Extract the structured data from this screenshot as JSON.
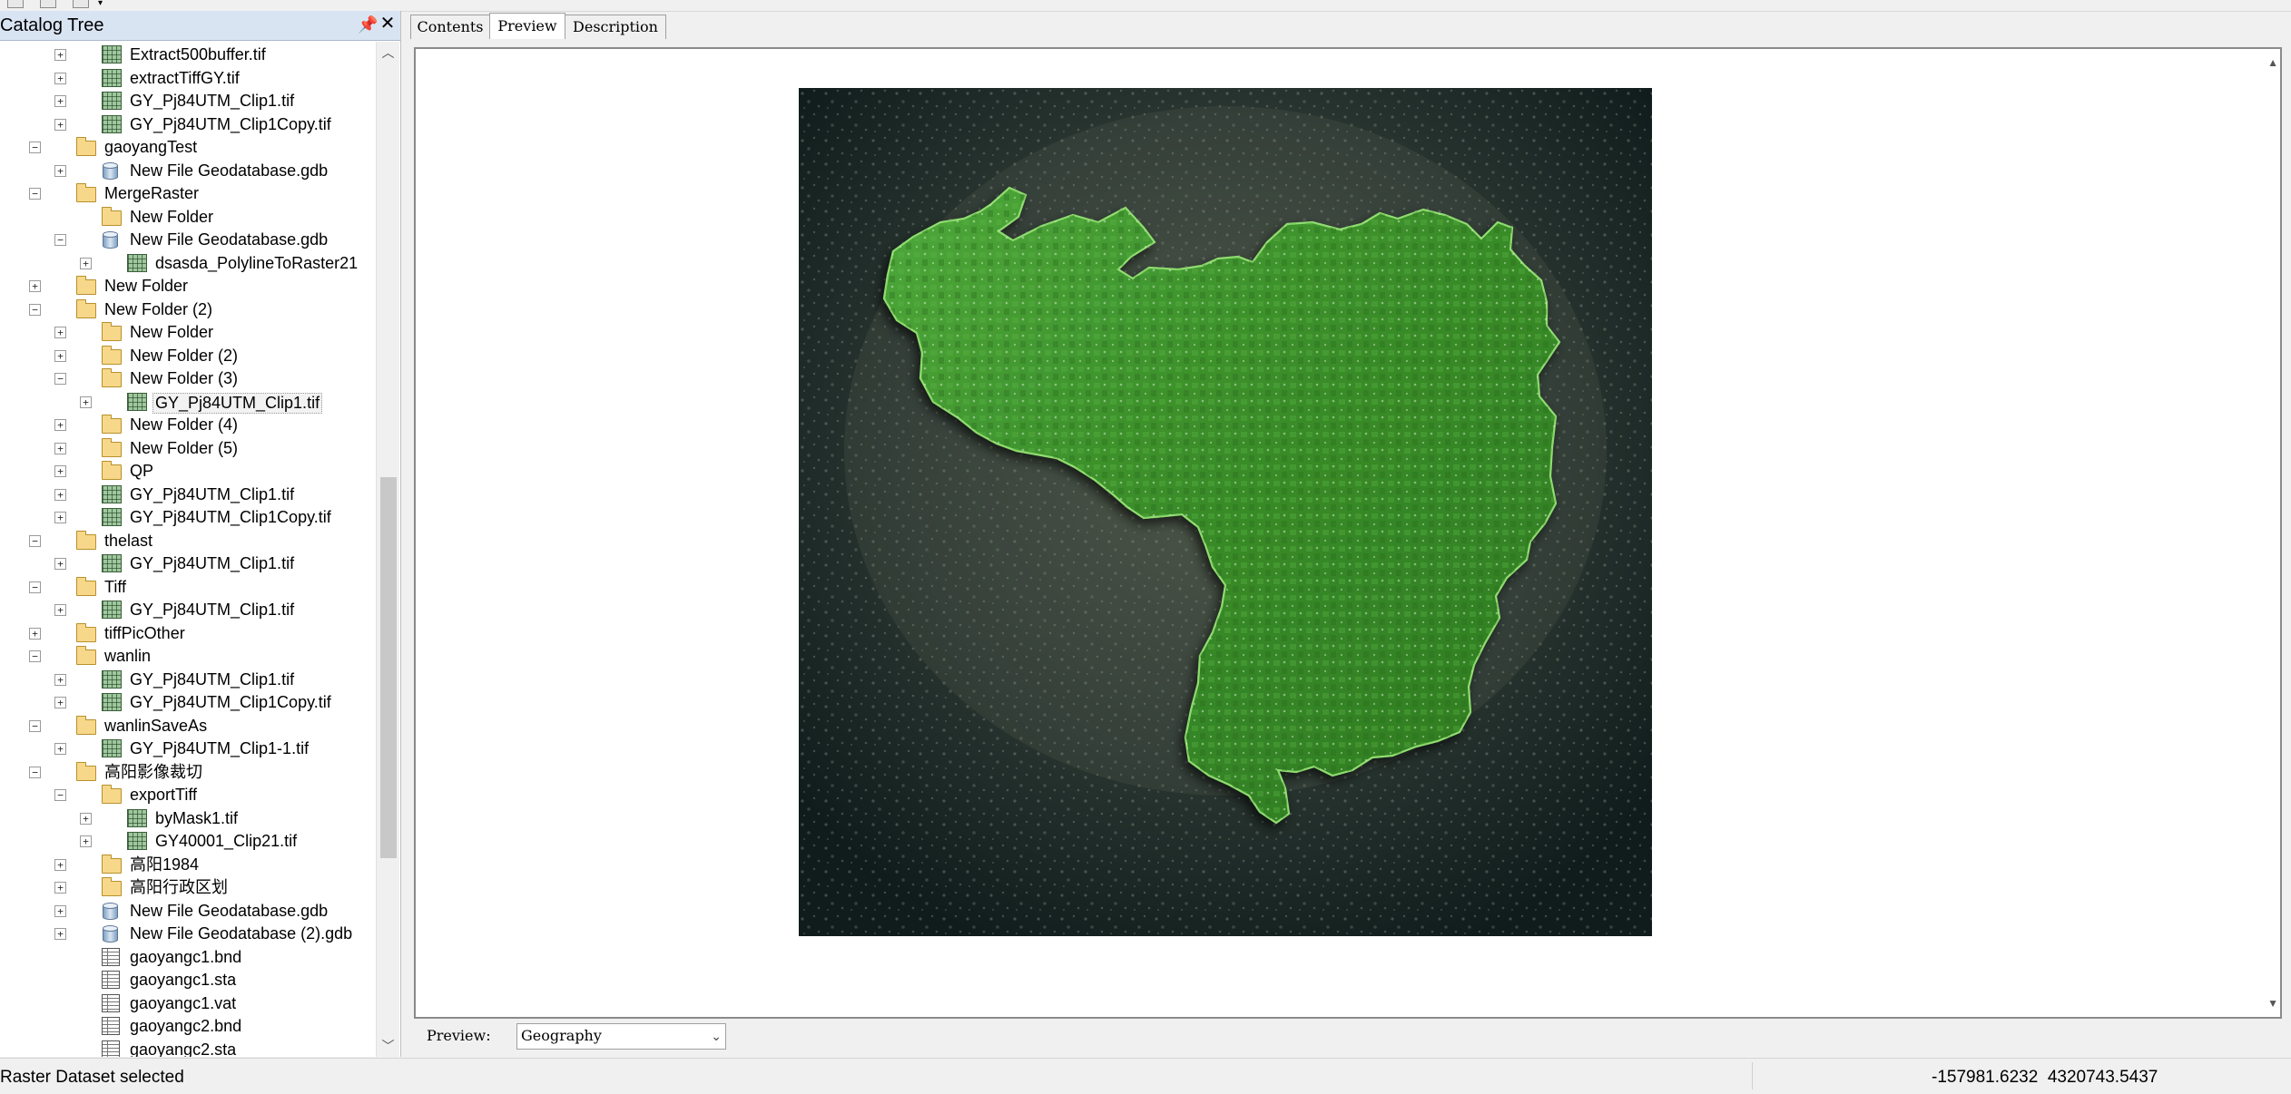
{
  "catalog": {
    "title": "Catalog Tree",
    "pin_glyph": "📌",
    "close_glyph": "✕",
    "items": [
      {
        "label": "Extract500buffer.tif",
        "indent": 2,
        "expander": "plus",
        "icon": "raster"
      },
      {
        "label": "extractTiffGY.tif",
        "indent": 2,
        "expander": "plus",
        "icon": "raster"
      },
      {
        "label": "GY_Pj84UTM_Clip1.tif",
        "indent": 2,
        "expander": "plus",
        "icon": "raster"
      },
      {
        "label": "GY_Pj84UTM_Clip1Copy.tif",
        "indent": 2,
        "expander": "plus",
        "icon": "raster"
      },
      {
        "label": "gaoyangTest",
        "indent": 1,
        "expander": "minus",
        "icon": "folder"
      },
      {
        "label": "New File Geodatabase.gdb",
        "indent": 2,
        "expander": "plus",
        "icon": "gdb"
      },
      {
        "label": "MergeRaster",
        "indent": 1,
        "expander": "minus",
        "icon": "folder"
      },
      {
        "label": "New Folder",
        "indent": 2,
        "expander": "none",
        "icon": "folder"
      },
      {
        "label": "New File Geodatabase.gdb",
        "indent": 2,
        "expander": "minus",
        "icon": "gdb"
      },
      {
        "label": "dsasda_PolylineToRaster21",
        "indent": 3,
        "expander": "plus",
        "icon": "raster"
      },
      {
        "label": "New Folder",
        "indent": 1,
        "expander": "plus",
        "icon": "folder"
      },
      {
        "label": "New Folder (2)",
        "indent": 1,
        "expander": "minus",
        "icon": "folder"
      },
      {
        "label": "New Folder",
        "indent": 2,
        "expander": "plus",
        "icon": "folder"
      },
      {
        "label": "New Folder (2)",
        "indent": 2,
        "expander": "plus",
        "icon": "folder"
      },
      {
        "label": "New Folder (3)",
        "indent": 2,
        "expander": "minus",
        "icon": "folder"
      },
      {
        "label": "GY_Pj84UTM_Clip1.tif",
        "indent": 3,
        "expander": "plus",
        "icon": "raster",
        "selected": true
      },
      {
        "label": "New Folder (4)",
        "indent": 2,
        "expander": "plus",
        "icon": "folder"
      },
      {
        "label": "New Folder (5)",
        "indent": 2,
        "expander": "plus",
        "icon": "folder"
      },
      {
        "label": "QP",
        "indent": 2,
        "expander": "plus",
        "icon": "folder"
      },
      {
        "label": "GY_Pj84UTM_Clip1.tif",
        "indent": 2,
        "expander": "plus",
        "icon": "raster"
      },
      {
        "label": "GY_Pj84UTM_Clip1Copy.tif",
        "indent": 2,
        "expander": "plus",
        "icon": "raster"
      },
      {
        "label": "thelast",
        "indent": 1,
        "expander": "minus",
        "icon": "folder"
      },
      {
        "label": "GY_Pj84UTM_Clip1.tif",
        "indent": 2,
        "expander": "plus",
        "icon": "raster"
      },
      {
        "label": "Tiff",
        "indent": 1,
        "expander": "minus",
        "icon": "folder"
      },
      {
        "label": "GY_Pj84UTM_Clip1.tif",
        "indent": 2,
        "expander": "plus",
        "icon": "raster"
      },
      {
        "label": "tiffPicOther",
        "indent": 1,
        "expander": "plus",
        "icon": "folder"
      },
      {
        "label": "wanlin",
        "indent": 1,
        "expander": "minus",
        "icon": "folder"
      },
      {
        "label": "GY_Pj84UTM_Clip1.tif",
        "indent": 2,
        "expander": "plus",
        "icon": "raster"
      },
      {
        "label": "GY_Pj84UTM_Clip1Copy.tif",
        "indent": 2,
        "expander": "plus",
        "icon": "raster"
      },
      {
        "label": "wanlinSaveAs",
        "indent": 1,
        "expander": "minus",
        "icon": "folder"
      },
      {
        "label": "GY_Pj84UTM_Clip1-1.tif",
        "indent": 2,
        "expander": "plus",
        "icon": "raster"
      },
      {
        "label": "高阳影像裁切",
        "indent": 1,
        "expander": "minus",
        "icon": "folder"
      },
      {
        "label": "exportTiff",
        "indent": 2,
        "expander": "minus",
        "icon": "folder"
      },
      {
        "label": "byMask1.tif",
        "indent": 3,
        "expander": "plus",
        "icon": "raster"
      },
      {
        "label": "GY40001_Clip21.tif",
        "indent": 3,
        "expander": "plus",
        "icon": "raster"
      },
      {
        "label": "高阳1984",
        "indent": 2,
        "expander": "plus",
        "icon": "folder"
      },
      {
        "label": "高阳行政区划",
        "indent": 2,
        "expander": "plus",
        "icon": "folder"
      },
      {
        "label": "New File Geodatabase.gdb",
        "indent": 2,
        "expander": "plus",
        "icon": "gdb"
      },
      {
        "label": "New File Geodatabase (2).gdb",
        "indent": 2,
        "expander": "plus",
        "icon": "gdb"
      },
      {
        "label": "gaoyangc1.bnd",
        "indent": 2,
        "expander": "none",
        "icon": "table"
      },
      {
        "label": "gaoyangc1.sta",
        "indent": 2,
        "expander": "none",
        "icon": "table"
      },
      {
        "label": "gaoyangc1.vat",
        "indent": 2,
        "expander": "none",
        "icon": "table"
      },
      {
        "label": "gaoyangc2.bnd",
        "indent": 2,
        "expander": "none",
        "icon": "table"
      },
      {
        "label": "gaoyangc2.sta",
        "indent": 2,
        "expander": "none",
        "icon": "table"
      }
    ],
    "scroll_up_glyph": "︿",
    "scroll_down_glyph": "﹀"
  },
  "tabs": [
    {
      "label": "Contents",
      "active": false
    },
    {
      "label": "Preview",
      "active": true
    },
    {
      "label": "Description",
      "active": false
    }
  ],
  "preview": {
    "label": "Preview:",
    "select_value": "Geography",
    "select_arrow": "⌄",
    "scroll_up_glyph": "▲",
    "scroll_down_glyph": "▼"
  },
  "status": {
    "text": "Raster Dataset selected",
    "coords": "-157981.6232  4320743.5437"
  },
  "colors": {
    "panel_header": "#d9e4f3",
    "raster_green": "#3f8f2a",
    "raster_background": "#1c2a27"
  }
}
